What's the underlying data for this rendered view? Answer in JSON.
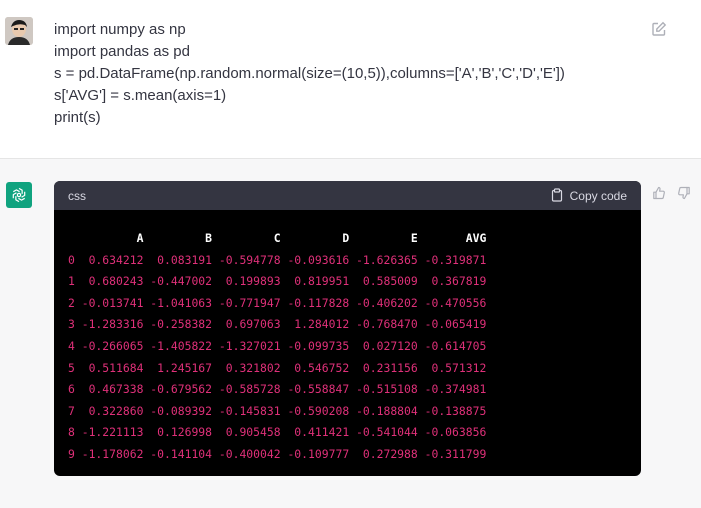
{
  "user": {
    "code_lines": [
      "import numpy as np",
      "import pandas as pd",
      "s = pd.DataFrame(np.random.normal(size=(10,5)),columns=['A','B','C','D','E'])",
      "s['AVG'] = s.mean(axis=1)",
      "print(s)"
    ]
  },
  "assistant": {
    "code_language": "css",
    "copy_label": "Copy code",
    "table": {
      "columns": [
        "A",
        "B",
        "C",
        "D",
        "E",
        "AVG"
      ],
      "rows": [
        {
          "index": "0",
          "values": [
            "0.634212",
            "0.083191",
            "-0.594778",
            "-0.093616",
            "-1.626365",
            "-0.319871"
          ]
        },
        {
          "index": "1",
          "values": [
            "0.680243",
            "-0.447002",
            "0.199893",
            "0.819951",
            "0.585009",
            "0.367819"
          ]
        },
        {
          "index": "2",
          "values": [
            "-0.013741",
            "-1.041063",
            "-0.771947",
            "-0.117828",
            "-0.406202",
            "-0.470556"
          ]
        },
        {
          "index": "3",
          "values": [
            "-1.283316",
            "-0.258382",
            "0.697063",
            "1.284012",
            "-0.768470",
            "-0.065419"
          ]
        },
        {
          "index": "4",
          "values": [
            "-0.266065",
            "-1.405822",
            "-1.327021",
            "-0.099735",
            "0.027120",
            "-0.614705"
          ]
        },
        {
          "index": "5",
          "values": [
            "0.511684",
            "1.245167",
            "0.321802",
            "0.546752",
            "0.231156",
            "0.571312"
          ]
        },
        {
          "index": "6",
          "values": [
            "0.467338",
            "-0.679562",
            "-0.585728",
            "-0.558847",
            "-0.515108",
            "-0.374981"
          ]
        },
        {
          "index": "7",
          "values": [
            "0.322860",
            "-0.089392",
            "-0.145831",
            "-0.590208",
            "-0.188804",
            "-0.138875"
          ]
        },
        {
          "index": "8",
          "values": [
            "-1.221113",
            "0.126998",
            "0.905458",
            "0.411421",
            "-0.541044",
            "-0.063856"
          ]
        },
        {
          "index": "9",
          "values": [
            "-1.178062",
            "-0.141104",
            "-0.400042",
            "-0.109777",
            "0.272988",
            "-0.311799"
          ]
        }
      ]
    }
  },
  "icons": {
    "edit": "edit-icon",
    "copy": "clipboard-icon",
    "thumbs_up": "thumbs-up-icon",
    "thumbs_down": "thumbs-down-icon",
    "assistant_logo": "openai-logo-icon"
  },
  "colors": {
    "user_bg": "#ffffff",
    "assistant_bg": "#f7f7f8",
    "code_bg": "#000000",
    "code_header_bg": "#343541",
    "code_value": "#df3079",
    "logo_bg": "#10a37f"
  }
}
